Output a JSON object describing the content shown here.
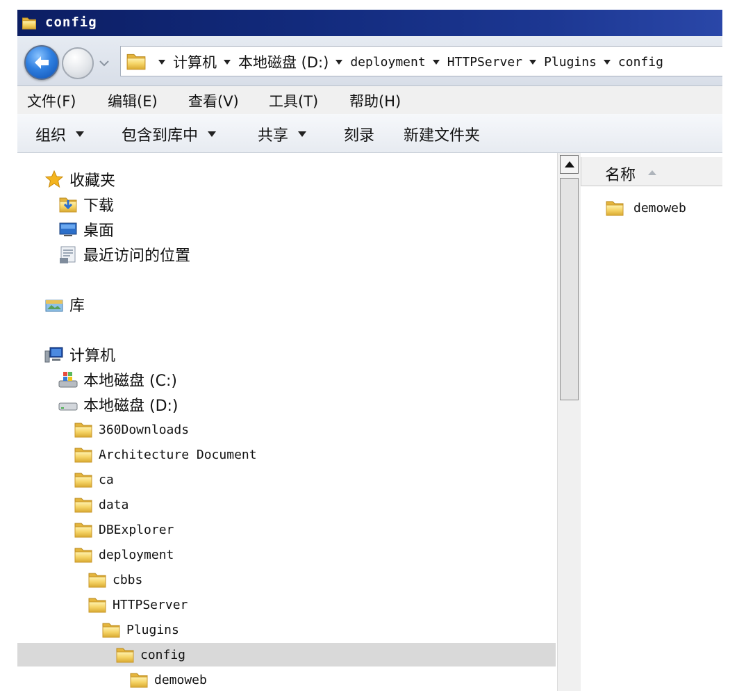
{
  "window": {
    "title": "config"
  },
  "address": {
    "crumbs": [
      {
        "label": "计算机",
        "mono": false
      },
      {
        "label": "本地磁盘 (D:)",
        "mono": false
      },
      {
        "label": "deployment",
        "mono": true
      },
      {
        "label": "HTTPServer",
        "mono": true
      },
      {
        "label": "Plugins",
        "mono": true
      },
      {
        "label": "config",
        "mono": true
      }
    ]
  },
  "menu": {
    "file": "文件(F)",
    "edit": "编辑(E)",
    "view": "查看(V)",
    "tools": "工具(T)",
    "help": "帮助(H)"
  },
  "commands": {
    "organize": "组织",
    "include_library": "包含到库中",
    "share": "共享",
    "burn": "刻录",
    "new_folder": "新建文件夹"
  },
  "tree": {
    "favorites": "收藏夹",
    "downloads": "下载",
    "desktop": "桌面",
    "recent": "最近访问的位置",
    "libraries": "库",
    "computer": "计算机",
    "drive_c": "本地磁盘 (C:)",
    "drive_d": "本地磁盘 (D:)",
    "folders": {
      "f360": "360Downloads",
      "arch": "Architecture Document",
      "ca": "ca",
      "data": "data",
      "dbexplorer": "DBExplorer",
      "deployment": "deployment",
      "cbbs": "cbbs",
      "httpserver": "HTTPServer",
      "plugins": "Plugins",
      "config": "config",
      "demoweb": "demoweb"
    }
  },
  "content": {
    "column_name": "名称",
    "items": [
      "demoweb"
    ]
  },
  "colors": {
    "titlebar": "#122a7c",
    "selection": "#d9d9d9",
    "folder": "#f2c94c"
  }
}
